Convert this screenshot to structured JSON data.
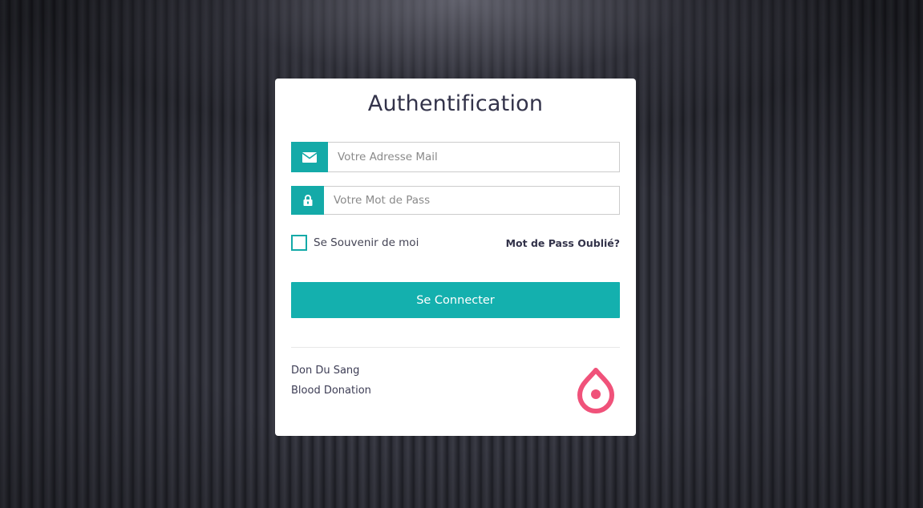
{
  "login": {
    "title": "Authentification",
    "email_placeholder": "Votre Adresse Mail",
    "password_placeholder": "Votre Mot de Pass",
    "remember_label": "Se Souvenir de moi",
    "forgot_label": "Mot de Pass Oublié?",
    "submit_label": "Se Connecter",
    "footer_line1": "Don Du Sang",
    "footer_line2": "Blood Donation",
    "email_icon": "envelope-icon",
    "password_icon": "lock-icon",
    "logo_icon": "blood-drop-icon"
  },
  "colors": {
    "accent": "#14aaa8",
    "logo": "#f0527a",
    "text": "#33334a"
  }
}
